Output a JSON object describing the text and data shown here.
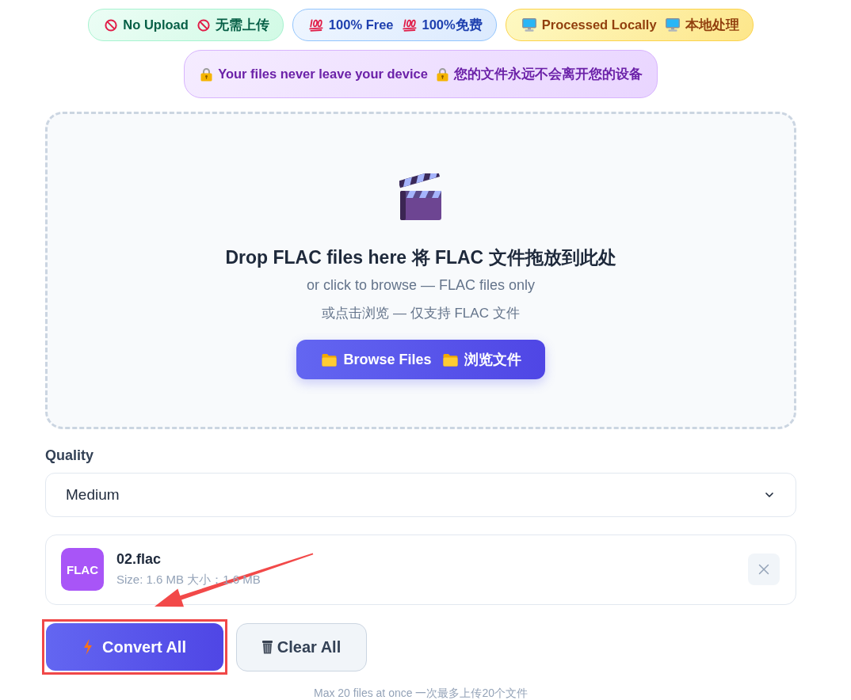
{
  "badge_rows": [
    [
      {
        "kind": "no-upload",
        "label": "No Upload",
        "label_zh": "无需上传"
      },
      {
        "kind": "free",
        "label": "100% Free",
        "label_zh": "100%免费"
      },
      {
        "kind": "local",
        "label": "Processed Locally",
        "label_zh": "本地处理"
      }
    ],
    [
      {
        "kind": "privacy",
        "label": "Your files never leave your device",
        "label_zh": "您的文件永远不会离开您的设备"
      }
    ]
  ],
  "drop_zone": {
    "title": "Drop FLAC files here 将 FLAC 文件拖放到此处",
    "subtitle": "or click to browse — FLAC files only",
    "subtitle_zh": "或点击浏览 — 仅支持 FLAC 文件",
    "browse_button": {
      "label": "Browse Files",
      "label_zh": "浏览文件"
    }
  },
  "quality": {
    "label": "Quality",
    "value": "Medium"
  },
  "files": [
    {
      "type_badge": "FLAC",
      "name": "02.flac",
      "size": "Size: 1.6 MB 大小：1.6 MB"
    }
  ],
  "buttons": [
    {
      "kind": "convert",
      "label": "Convert All"
    },
    {
      "kind": "clear",
      "label": "Clear All"
    }
  ],
  "footer": "Max 20 files at once 一次最多上传20个文件"
}
